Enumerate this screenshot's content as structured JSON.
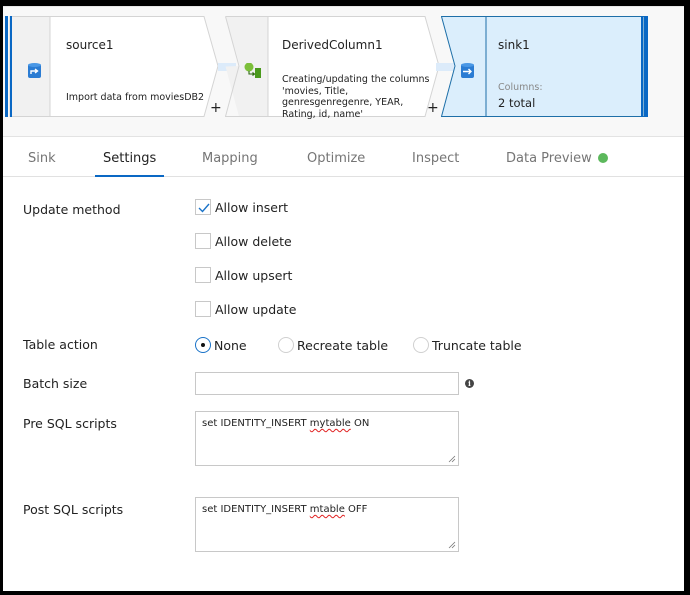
{
  "flow": {
    "nodes": [
      {
        "id": "source",
        "title": "source1",
        "description": "Import data from moviesDB2",
        "icon": "source-dataset-icon"
      },
      {
        "id": "derived",
        "title": "DerivedColumn1",
        "description_lines": [
          "Creating/updating the columns",
          "'movies, Title,",
          "genresgenregenre, YEAR,",
          "Rating, id, name'"
        ],
        "icon": "derived-column-icon"
      },
      {
        "id": "sink",
        "title": "sink1",
        "columns_label": "Columns:",
        "columns_value": "2 total",
        "icon": "sink-dataset-icon",
        "selected": true
      }
    ],
    "add_symbol": "+"
  },
  "tabs": [
    {
      "label": "Sink",
      "active": false
    },
    {
      "label": "Settings",
      "active": true
    },
    {
      "label": "Mapping",
      "active": false
    },
    {
      "label": "Optimize",
      "active": false
    },
    {
      "label": "Inspect",
      "active": false
    },
    {
      "label": "Data Preview",
      "active": false,
      "status_color": "#5cb85c"
    }
  ],
  "settings": {
    "update_method": {
      "label": "Update method",
      "options": [
        {
          "label": "Allow insert",
          "checked": true
        },
        {
          "label": "Allow delete",
          "checked": false
        },
        {
          "label": "Allow upsert",
          "checked": false
        },
        {
          "label": "Allow update",
          "checked": false
        }
      ]
    },
    "table_action": {
      "label": "Table action",
      "options": [
        {
          "label": "None",
          "selected": true
        },
        {
          "label": "Recreate table",
          "selected": false
        },
        {
          "label": "Truncate table",
          "selected": false
        }
      ]
    },
    "batch_size": {
      "label": "Batch size",
      "value": "",
      "info_icon": "i"
    },
    "pre_sql": {
      "label": "Pre SQL scripts",
      "prefix": "set IDENTITY_INSERT ",
      "flagged_word": "mytable",
      "suffix": " ON"
    },
    "post_sql": {
      "label": "Post SQL scripts",
      "prefix": "set IDENTITY_INSERT ",
      "flagged_word": "mtable",
      "suffix": " OFF"
    }
  },
  "colors": {
    "accent": "#0a68c4",
    "selected_node_bg": "#dbeefc",
    "node_border_selected": "#1e6fa8",
    "status_green": "#5cb85c"
  }
}
